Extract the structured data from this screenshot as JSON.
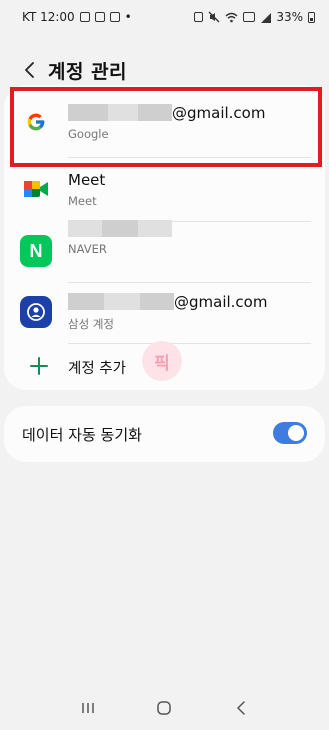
{
  "status_bar": {
    "carrier_time": "KT 12:00",
    "dot": "•",
    "battery_percent": "33%"
  },
  "header": {
    "title": "계정 관리"
  },
  "accounts": [
    {
      "name_suffix": "@gmail.com",
      "type": "Google",
      "icon": "google-icon",
      "highlighted": true
    },
    {
      "name": "Meet",
      "type": "Meet",
      "icon": "meet-icon"
    },
    {
      "name": "",
      "type": "NAVER",
      "icon": "naver-icon"
    },
    {
      "name_suffix": "@gmail.com",
      "type": "삼성 계정",
      "icon": "samsung-account-icon"
    }
  ],
  "add_account": {
    "label": "계정 추가",
    "watermark": "픽"
  },
  "sync": {
    "label": "데이터 자동 동기화",
    "enabled": true
  },
  "colors": {
    "highlight": "#e41b23",
    "toggle_on": "#3e7ce0",
    "add_icon": "#1a8a56"
  }
}
